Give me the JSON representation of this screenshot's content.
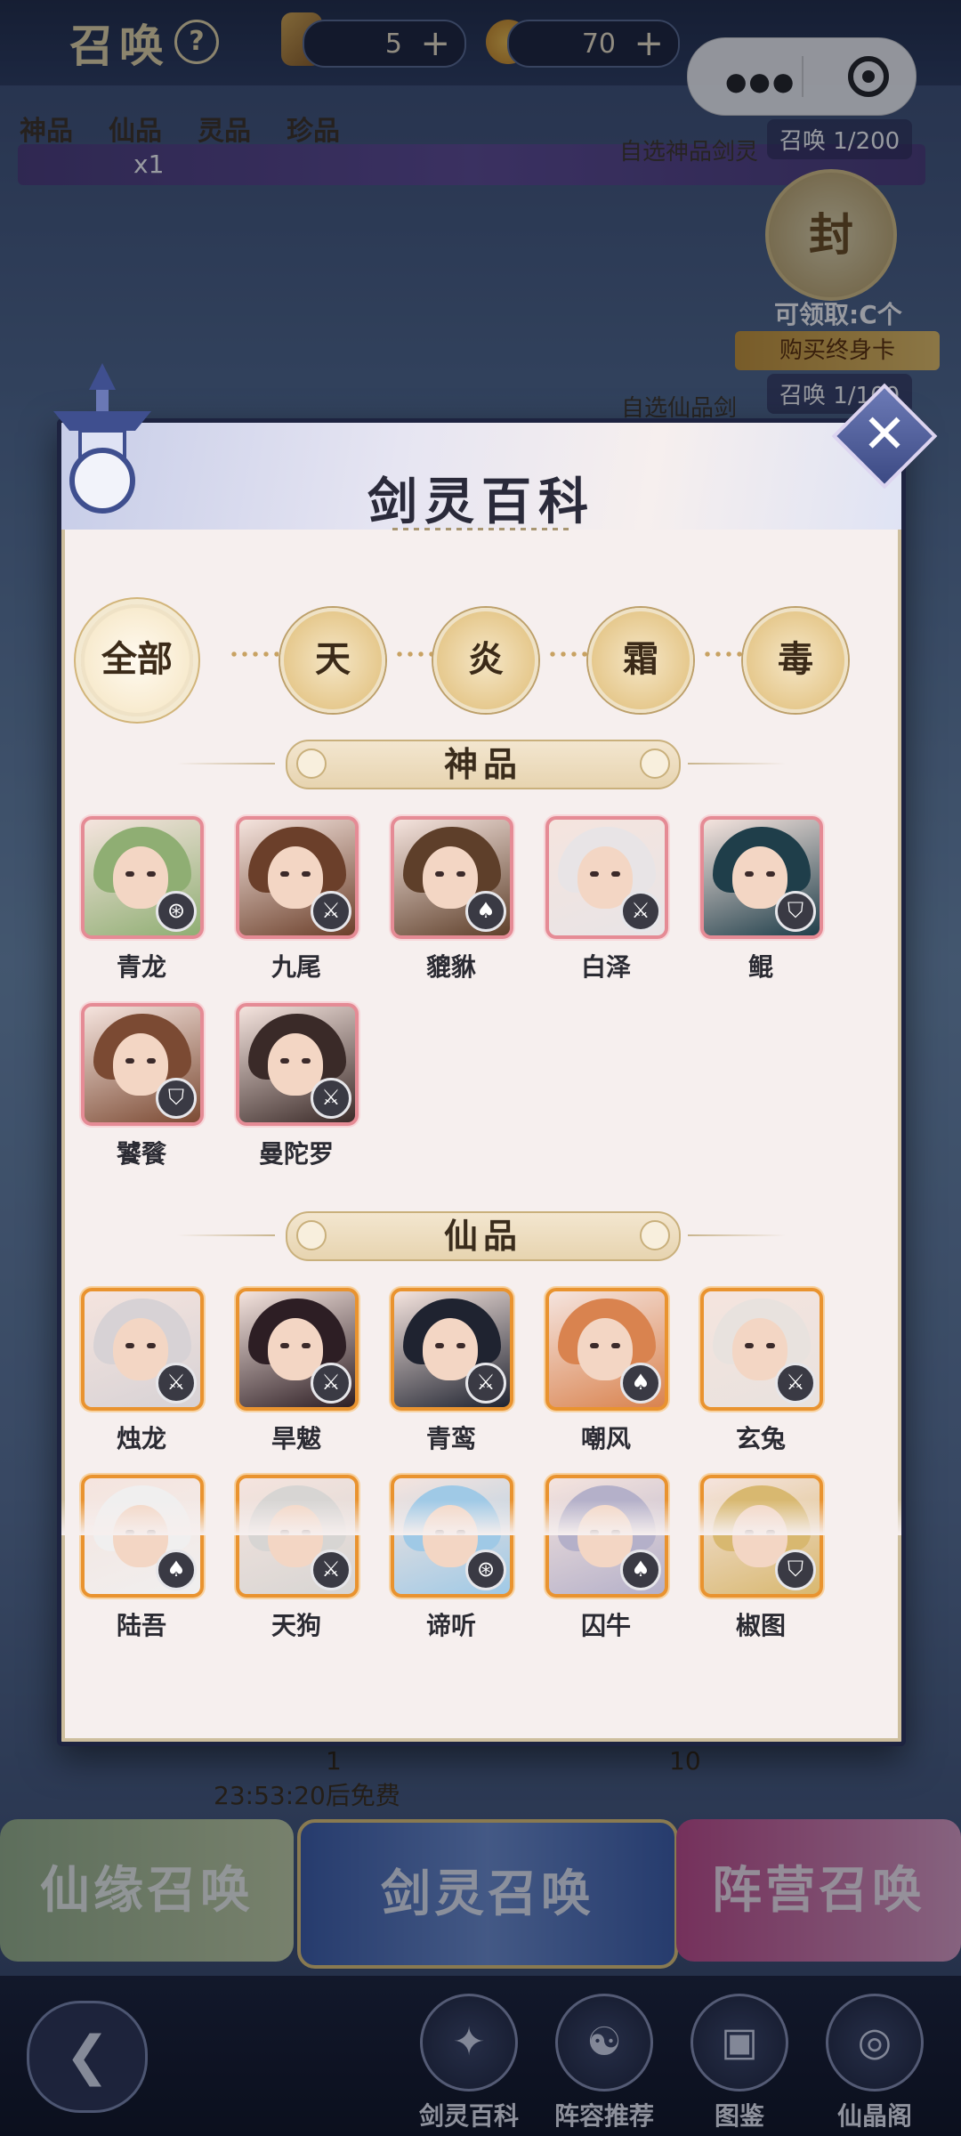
{
  "header": {
    "title": "召唤",
    "help_icon": "?",
    "currency_1": "5",
    "currency_2": "70",
    "plus": "+"
  },
  "background": {
    "tiers": [
      "神品",
      "仙品",
      "灵品",
      "珍品"
    ],
    "banner_multiplier": "x1",
    "select_god_label": "自选神品剑灵",
    "summon_god_count": "召唤 1/200",
    "claimable": "可领取:C个",
    "buy_card": "购买终身卡",
    "select_fairy_label": "自选仙品剑",
    "summon_fairy_count": "召唤 1/100",
    "seal_glyph": "封",
    "timer_cost": "1",
    "timer": "23:53:20后免费",
    "mid_cost": "10",
    "buttons": [
      "仙缘召唤",
      "剑灵召唤",
      "阵营召唤"
    ]
  },
  "dock": {
    "back_icon": "back-arrow-icon",
    "back_glyph": "❮",
    "items": [
      {
        "label": "剑灵百科",
        "glyph": "✦"
      },
      {
        "label": "阵容推荐",
        "glyph": "☯"
      },
      {
        "label": "图鉴",
        "glyph": "▣"
      },
      {
        "label": "仙晶阁",
        "glyph": "◎"
      }
    ]
  },
  "modal": {
    "title": "剑灵百科",
    "close": "✕",
    "filters": [
      "全部",
      "天",
      "炎",
      "霜",
      "毒"
    ],
    "active_filter": "全部",
    "sections": [
      {
        "title": "神品",
        "rarity": "god",
        "cards": [
          {
            "name": "青龙",
            "badge": "⊛",
            "hair": "#8fae73"
          },
          {
            "name": "九尾",
            "badge": "⚔",
            "hair": "#6b3f2a"
          },
          {
            "name": "貔貅",
            "badge": "♠",
            "hair": "#5e3f2a"
          },
          {
            "name": "白泽",
            "badge": "⚔",
            "hair": "#e8e4e6"
          },
          {
            "name": "鲲",
            "badge": "⛉",
            "hair": "#1f3e4a"
          },
          {
            "name": "饕餮",
            "badge": "⛉",
            "hair": "#7b4a33"
          },
          {
            "name": "曼陀罗",
            "badge": "⚔",
            "hair": "#3a2a28"
          }
        ]
      },
      {
        "title": "仙品",
        "rarity": "fairy",
        "cards": [
          {
            "name": "烛龙",
            "badge": "⚔",
            "hair": "#d7d2d5"
          },
          {
            "name": "旱魃",
            "badge": "⚔",
            "hair": "#2d1e24"
          },
          {
            "name": "青鸾",
            "badge": "⚔",
            "hair": "#1f2330"
          },
          {
            "name": "嘲风",
            "badge": "♠",
            "hair": "#d9834f"
          },
          {
            "name": "玄兔",
            "badge": "⚔",
            "hair": "#e8e2de"
          },
          {
            "name": "陆吾",
            "badge": "♠",
            "hair": "#f0efef"
          },
          {
            "name": "天狗",
            "badge": "⚔",
            "hair": "#d7d5d3"
          },
          {
            "name": "谛听",
            "badge": "⊛",
            "hair": "#9fc9e6"
          },
          {
            "name": "囚牛",
            "badge": "♠",
            "hair": "#b4b0c9"
          },
          {
            "name": "椒图",
            "badge": "⛉",
            "hair": "#d8b870"
          }
        ]
      }
    ],
    "colors": {
      "frame": "#1d2340",
      "god_border": "#e58b95",
      "fairy_border": "#e9932f",
      "paper": "#f6efee"
    }
  }
}
